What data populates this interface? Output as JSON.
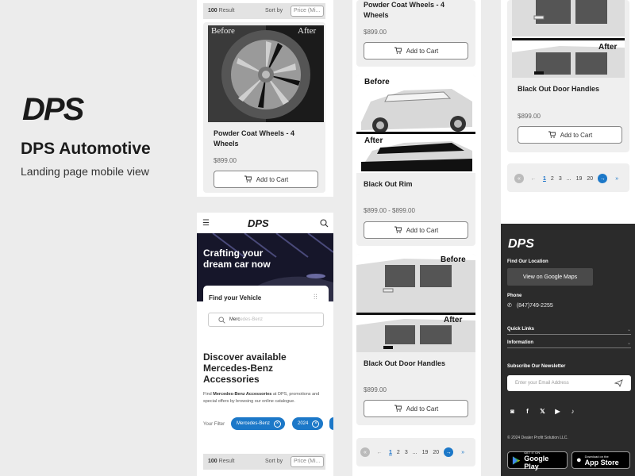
{
  "brand": {
    "logo_text": "DPS",
    "name": "DPS Automotive",
    "subtitle": "Landing page mobile view"
  },
  "sort_bar": {
    "count": "100",
    "result_label": "Result",
    "sort_label": "Sort by",
    "sort_value": "Price (Mi..."
  },
  "products": [
    {
      "title": "Powder Coat Wheels - 4 Wheels",
      "price": "$899.00",
      "button": "Add to Cart",
      "before": "Before",
      "after": "After"
    },
    {
      "title": "Black Out Rim",
      "price": "$899.00 - $899.00",
      "button": "Add to Cart",
      "before": "Before",
      "after": "After"
    },
    {
      "title": "Black Out Door Handles",
      "price": "$899.00",
      "button": "Add to Cart",
      "before": "Before",
      "after": "After"
    }
  ],
  "pagination": {
    "pages": [
      "1",
      "2",
      "3",
      "...",
      "19",
      "20"
    ],
    "active": "1"
  },
  "mobile": {
    "logo": "DPS",
    "hero_title": "Crafting your dream car now",
    "find_vehicle": "Find your Vehicle",
    "search_value": "Merc",
    "search_placeholder": "edes-Benz",
    "discover_title": "Discover available Mercedes-Benz Accessories",
    "discover_text_pre": "Find ",
    "discover_text_bold": "Mercedes-Benz Accessories",
    "discover_text_post": " at DPS, promotions and special offers by browsing our online catalogue.",
    "filter_label": "Your Filter",
    "chips": [
      "Mercedes-Benz",
      "2024"
    ]
  },
  "footer": {
    "logo": "DPS",
    "location_label": "Find Our Location",
    "maps_button": "View on Google Maps",
    "phone_label": "Phone",
    "phone": "(847)749-2255",
    "quick_links": "Quick Links",
    "information": "Information",
    "newsletter_label": "Subscribe Our Newsletter",
    "email_placeholder": "Enter your Email Address",
    "copyright": "© 2024 Dealer Profit Solution LLC.",
    "google_play_small": "GET IT ON",
    "google_play_big": "Google Play",
    "app_store_small": "Download on the",
    "app_store_big": "App Store"
  },
  "colors": {
    "accent": "#1c78c8",
    "footer_bg": "#2b2b2b"
  }
}
